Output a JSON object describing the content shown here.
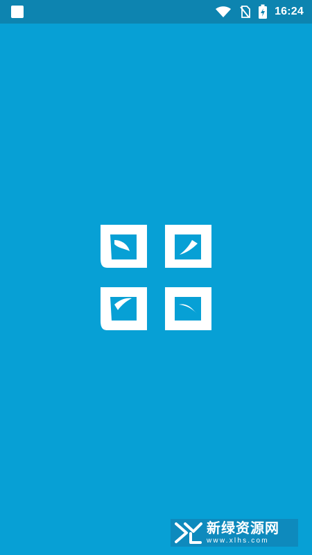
{
  "status_bar": {
    "time": "16:24",
    "icons": [
      "app-notification-icon",
      "wifi-icon",
      "no-sim-icon",
      "battery-charging-icon"
    ]
  },
  "splash": {
    "logo_icon": "four-leaf-logo-icon",
    "background_color": "#07a0d5",
    "status_bar_color": "#0d84b0"
  },
  "watermark": {
    "logo_icon": "xl-logo-icon",
    "title": "新绿资源网",
    "url": "www.xlhs.com"
  }
}
